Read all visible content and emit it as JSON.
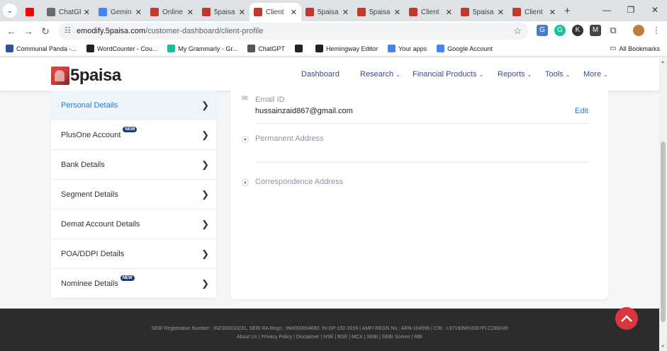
{
  "browser": {
    "tabs": [
      {
        "title": "",
        "favicon_color": "#ff0000"
      },
      {
        "title": "ChatGP",
        "favicon_color": "#6b6b6b"
      },
      {
        "title": "Gemin",
        "favicon_color": "#4285f4"
      },
      {
        "title": "Online",
        "favicon_color": "#c0392b"
      },
      {
        "title": "5paisa",
        "favicon_color": "#c0392b"
      },
      {
        "title": "Client",
        "favicon_color": "#c0392b",
        "active": true
      },
      {
        "title": "5paisa",
        "favicon_color": "#c0392b"
      },
      {
        "title": "5paisa",
        "favicon_color": "#c0392b"
      },
      {
        "title": "Client",
        "favicon_color": "#c0392b"
      },
      {
        "title": "5paisa",
        "favicon_color": "#c0392b"
      },
      {
        "title": "Client",
        "favicon_color": "#c0392b"
      }
    ],
    "url_host": "emodify.5paisa.com",
    "url_path": "/customer-dashboard/client-profile",
    "bookmarks": [
      {
        "label": "Communal Panda -...",
        "icon_color": "#2a5699"
      },
      {
        "label": "WordCounter - Cou...",
        "icon_color": "#222222"
      },
      {
        "label": "My Grammarly - Gr...",
        "icon_color": "#15c39a"
      },
      {
        "label": "ChatGPT",
        "icon_color": "#555555"
      },
      {
        "label": "",
        "icon_color": "#222222"
      },
      {
        "label": "Hemingway Editor",
        "icon_color": "#222222"
      },
      {
        "label": "Your apps",
        "icon_color": "#4285f4"
      },
      {
        "label": "Google Account",
        "icon_color": "#4285f4"
      }
    ],
    "all_bookmarks": "All Bookmarks"
  },
  "site": {
    "logo_text": "5paisa",
    "nav": {
      "dashboard": "Dashboard",
      "research": "Research",
      "financial_products": "Financial Products",
      "reports": "Reports",
      "tools": "Tools",
      "more": "More"
    },
    "sidebar": [
      {
        "label": "Personal Details",
        "active": true,
        "badge": ""
      },
      {
        "label": "PlusOne Account",
        "badge": "NEW"
      },
      {
        "label": "Bank Details",
        "badge": ""
      },
      {
        "label": "Segment Details",
        "badge": ""
      },
      {
        "label": "Demat Account Details",
        "badge": ""
      },
      {
        "label": "POA/DDPI Details",
        "badge": ""
      },
      {
        "label": "Nominee Details",
        "badge": "NEW"
      }
    ],
    "profile": {
      "email_label": "Email ID",
      "email_value": "hussainzaid867@gmail.com",
      "edit_label": "Edit",
      "permanent_address_label": "Permanent Address",
      "correspondence_address_label": "Correspondence Address"
    },
    "footer": {
      "line1": "SEBI Registration Number : INZ000010231, SEBI RA Regn.: INH000004680, IN-DP-192-2016 | AMFI REGN No.: ARN-104096 | CIN : L67190MH2007PLC289249",
      "line2": "About Us | Privacy Policy | Disclaimer | NSE | BSE | MCX | SEBI | SEBI Scores | RBI"
    }
  },
  "colors": {
    "brand_red": "#d9363e",
    "link_blue": "#2a7bd5",
    "nav_blue": "#3a4b8a"
  }
}
